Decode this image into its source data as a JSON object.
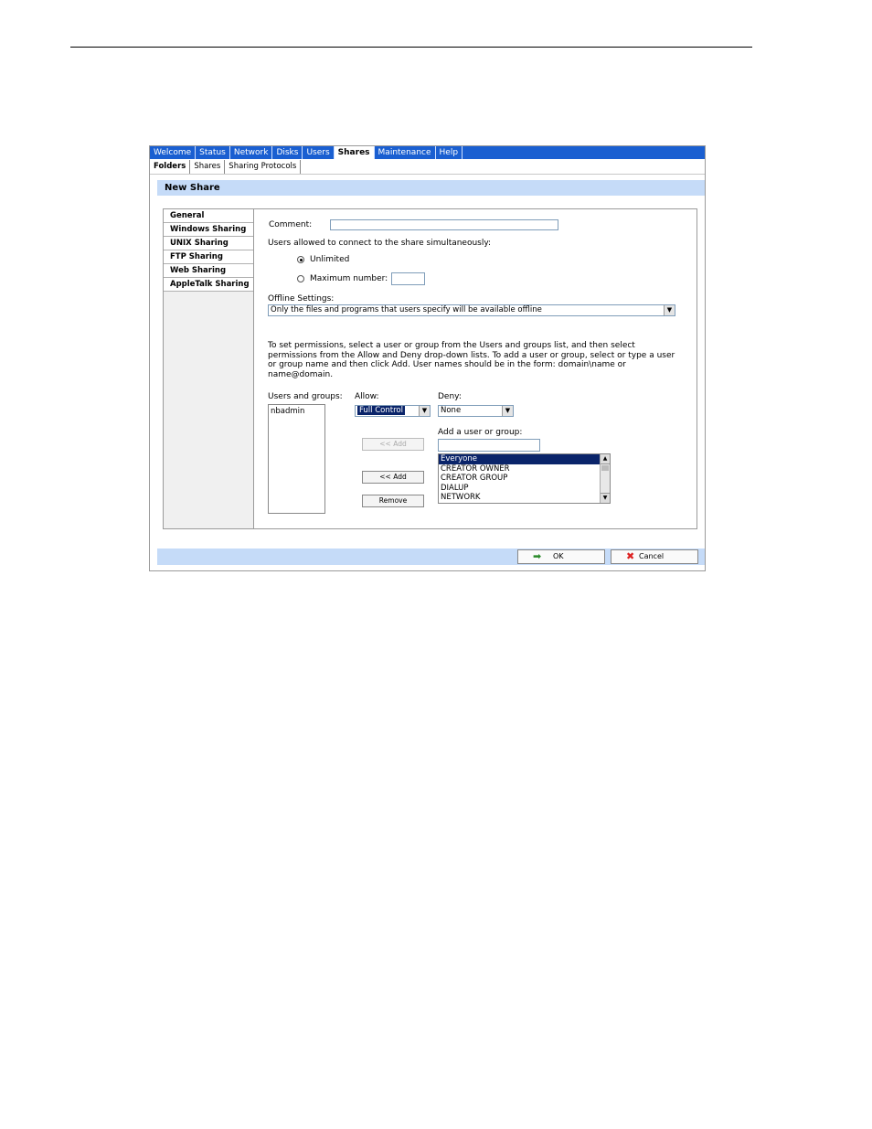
{
  "nav": {
    "tabs": [
      "Welcome",
      "Status",
      "Network",
      "Disks",
      "Users",
      "Shares",
      "Maintenance",
      "Help"
    ],
    "active": "Shares"
  },
  "subnav": {
    "tabs": [
      "Folders",
      "Shares",
      "Sharing Protocols"
    ],
    "active": "Folders"
  },
  "page_title": "New Share",
  "sidebar": {
    "items": [
      "General",
      "Windows Sharing",
      "UNIX Sharing",
      "FTP Sharing",
      "Web Sharing",
      "AppleTalk Sharing"
    ]
  },
  "form": {
    "comment_label": "Comment:",
    "comment_value": "",
    "users_allowed_label": "Users allowed to connect to the share simultaneously:",
    "unlimited_label": "Unlimited",
    "max_number_label": "Maximum number:",
    "max_number_value": "",
    "offline_label": "Offline Settings:",
    "offline_value": "Only the files and programs that users specify will be available offline",
    "instructions": "To set permissions, select a user or group from the Users and groups list, and then select permissions from the Allow and Deny drop-down lists. To add a user or group, select or type a user or group name and then click Add. User names should be in the form: domain\\name or name@domain.",
    "users_groups_label": "Users and groups:",
    "users_groups": [
      "nbadmin"
    ],
    "allow_label": "Allow:",
    "allow_value": "Full Control",
    "deny_label": "Deny:",
    "deny_value": "None",
    "add_user_label": "Add a user or group:",
    "add_user_value": "",
    "add_disabled_label": "<< Add",
    "add_label": "<< Add",
    "remove_label": "Remove",
    "group_list": [
      "Everyone",
      "CREATOR OWNER",
      "CREATOR GROUP",
      "DIALUP",
      "NETWORK"
    ],
    "group_list_selected": "Everyone"
  },
  "footer": {
    "ok_label": "OK",
    "cancel_label": "Cancel"
  },
  "colors": {
    "nav_bg": "#1a5fd1",
    "title_bar_bg": "#c5dbf8",
    "selection": "#0a246a"
  }
}
